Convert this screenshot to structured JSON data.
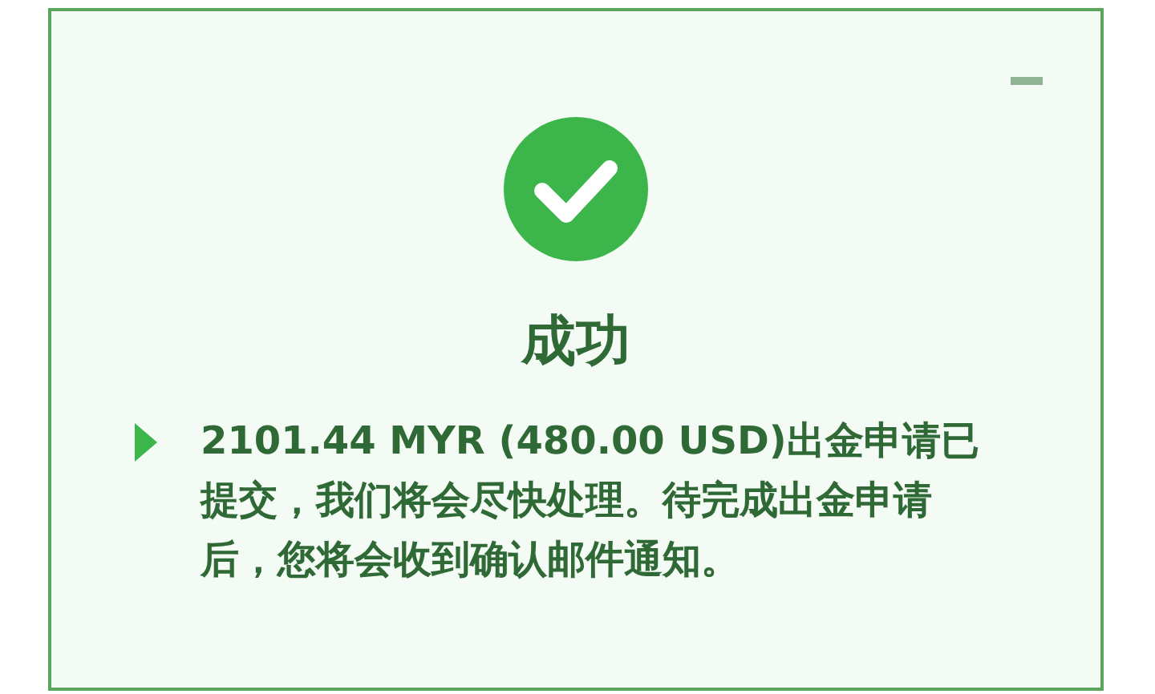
{
  "dialog": {
    "minimized": false,
    "kind": "success",
    "title": "成功",
    "message": "2101.44 MYR (480.00 USD)出金申请已提交，我们将会尽快处理。待完成出金申请后，您将会收到确认邮件通知。"
  }
}
